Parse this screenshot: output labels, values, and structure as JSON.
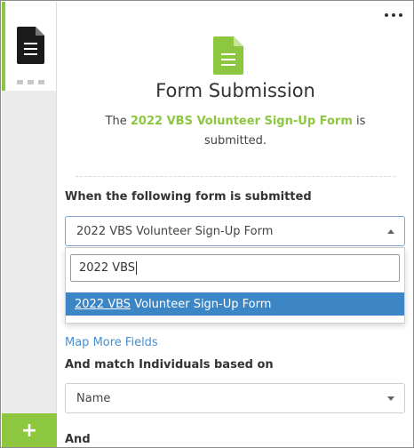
{
  "rail": {
    "doc_icon": "document-icon",
    "handle_icon": "drag-handle-icon",
    "add_label": "+"
  },
  "header": {
    "more_icon": "more-options-icon",
    "icon": "form-document-icon",
    "title": "Form Submission",
    "desc_prefix": "The",
    "form_name": "2022 VBS Volunteer Sign-Up Form",
    "desc_suffix": "is submitted."
  },
  "trigger": {
    "label": "When the following form is submitted",
    "selected": "2022 VBS Volunteer Sign-Up Form",
    "search_value": "2022 VBS",
    "option_match": "2022 VBS",
    "option_rest": " Volunteer Sign-Up Form"
  },
  "map_more_label": "Map More Fields",
  "match": {
    "label": "And match Individuals based on",
    "selected": "Name"
  },
  "and_label": "And",
  "colors": {
    "accent_green": "#8dc63f",
    "option_blue": "#3d86c6",
    "link_blue": "#4a8fd0"
  }
}
